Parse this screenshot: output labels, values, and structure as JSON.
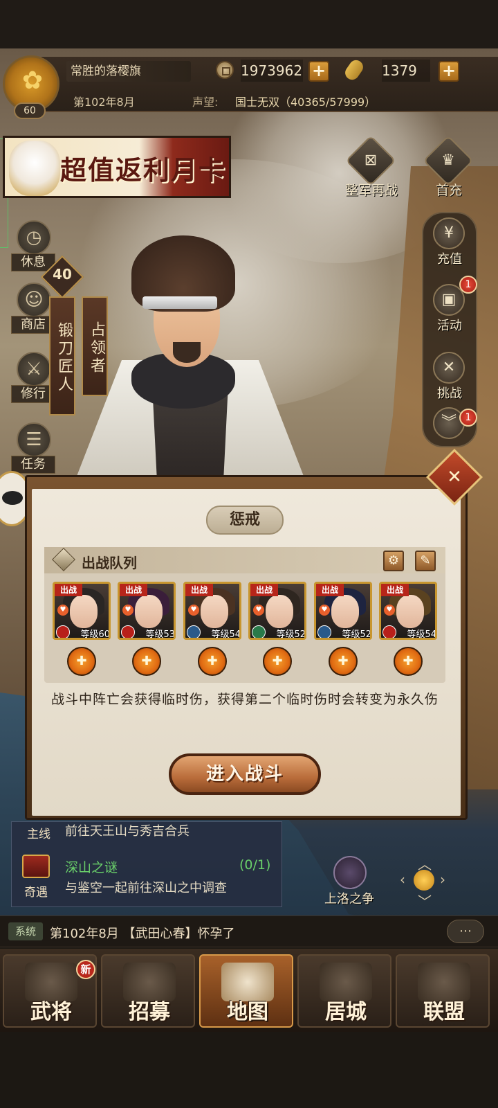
{
  "player": {
    "flag_name": "常胜的落樱旗",
    "level": "60",
    "date": "第102年8月",
    "reputation_label": "声望:",
    "reputation_value": "国士无双（40365/57999）"
  },
  "currencies": {
    "coins": "1973962",
    "koban": "1379",
    "plus": "+"
  },
  "banner": {
    "text": "超值返利月卡"
  },
  "left_menu": [
    {
      "label": "休息",
      "icon": "clock-icon",
      "glyph": "◷"
    },
    {
      "label": "商店",
      "icon": "lucky-cat-icon",
      "glyph": "☺"
    },
    {
      "label": "修行",
      "icon": "sword-icon",
      "glyph": "⚔"
    },
    {
      "label": "任务",
      "icon": "scroll-icon",
      "glyph": "☰"
    }
  ],
  "top_right": [
    {
      "label": "整军再战",
      "icon": "banner-icon",
      "glyph": "⊠"
    },
    {
      "label": "首充",
      "icon": "gift-icon",
      "glyph": "♛"
    }
  ],
  "right_menu": [
    {
      "label": "充值",
      "icon": "yen-icon",
      "glyph": "¥",
      "badge": ""
    },
    {
      "label": "活动",
      "icon": "lantern-icon",
      "glyph": "▣",
      "badge": "1"
    },
    {
      "label": "挑战",
      "icon": "crossed-swords-icon",
      "glyph": "✕",
      "badge": ""
    },
    {
      "label": "",
      "icon": "chevron-down-icon",
      "glyph": "︾",
      "badge": "1"
    }
  ],
  "character": {
    "level": "40",
    "occupation": "锻刀匠人",
    "status": "占领者"
  },
  "dialog": {
    "title": "惩戒",
    "team_label": "出战队列",
    "info": "战斗中阵亡会获得临时伤，获得第二个临时伤时会转变为永久伤",
    "battle_button": "进入战斗",
    "close_glyph": "✕",
    "settings_glyph": "⚙",
    "edit_glyph": "✎"
  },
  "heroes": [
    {
      "sortie": "出战",
      "level": "等级60",
      "hair": "#2a2624",
      "clan_color": "#b8201a"
    },
    {
      "sortie": "出战",
      "level": "等级53",
      "hair": "#3a1e3a",
      "clan_color": "#b8201a"
    },
    {
      "sortie": "出战",
      "level": "等级54",
      "hair": "#4a3222",
      "clan_color": "#2a5a8a"
    },
    {
      "sortie": "出战",
      "level": "等级52",
      "hair": "#2e2620",
      "clan_color": "#2a7a4a"
    },
    {
      "sortie": "出战",
      "level": "等级52",
      "hair": "#1e2440",
      "clan_color": "#2a5a8a"
    },
    {
      "sortie": "出战",
      "level": "等级54",
      "hair": "#5a4220",
      "clan_color": "#b8201a"
    }
  ],
  "heal_glyph": "✚",
  "quests": [
    {
      "tag": "主线",
      "text": "前往天王山与秀吉合兵"
    },
    {
      "tag": "奇遇",
      "title": "深山之谜",
      "count": "(0/1)",
      "text": "与鉴空一起前往深山之中调查"
    }
  ],
  "map_event": {
    "label": "上洛之争"
  },
  "system": {
    "tag": "系统",
    "message": "第102年8月 【武田心春】怀孕了",
    "chat_glyph": "⋯"
  },
  "bottom_nav": [
    {
      "label": "武将",
      "badge": "新",
      "active": false
    },
    {
      "label": "招募",
      "badge": "",
      "active": false
    },
    {
      "label": "地图",
      "badge": "",
      "active": true
    },
    {
      "label": "居城",
      "badge": "",
      "active": false
    },
    {
      "label": "联盟",
      "badge": "",
      "active": false
    }
  ],
  "colors": {
    "accent_gold": "#c8962f",
    "button_brown": "#b96c3a",
    "quest_green": "#6ad06a",
    "alert_red": "#b8281c"
  }
}
